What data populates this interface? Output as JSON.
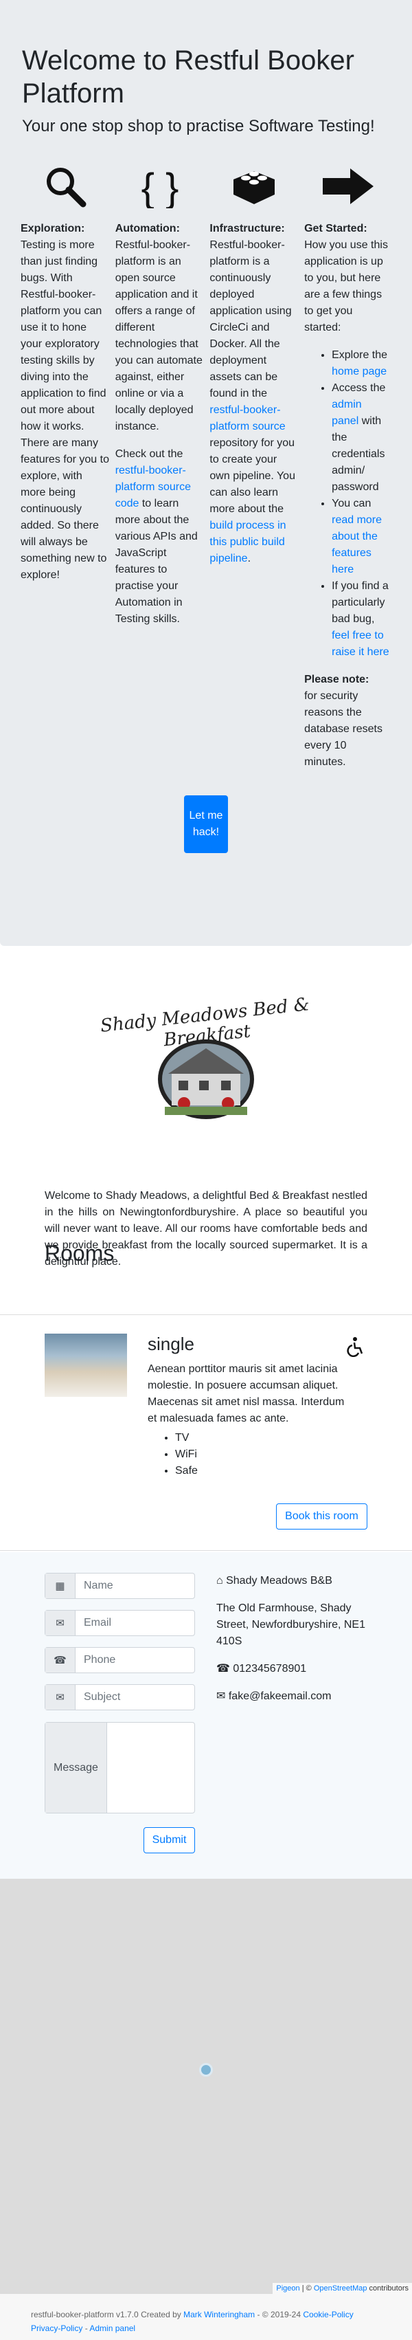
{
  "hero": {
    "title": "Welcome to Restful Booker Platform",
    "lead": "Your one stop shop to practise Software Testing!",
    "exploration": {
      "heading": "Exploration:",
      "text": "Testing is more than just finding bugs. With Restful-booker-platform you can use it to hone your exploratory testing skills by diving into the application to find out more about how it works. There are many features for you to explore, with more being continuously added. So there will always be something new to explore!"
    },
    "automation": {
      "heading": "Automation:",
      "text": "Restful-booker-platform is an open source application and it offers a range of different technologies that you can automate against, either online or via a locally deployed instance.",
      "text2_pre": "Check out the ",
      "link": "restful-booker-platform source code",
      "text2_post": " to learn more about the various APIs and JavaScript features to practise your Automation in Testing skills."
    },
    "infrastructure": {
      "heading": "Infrastructure:",
      "text_pre": "Restful-booker-platform is a continuously deployed application using CircleCi and Docker. All the deployment assets can be found in the ",
      "link1": "restful-booker-platform source",
      "text_mid": " repository for you to create your own pipeline. You can also learn more about the ",
      "link2": "build process in this public build pipeline",
      "text_post": "."
    },
    "started": {
      "heading": "Get Started:",
      "text": "How you use this application is up to you, but here are a few things to get you started:",
      "li1_pre": "Explore the ",
      "li1_link": "home page",
      "li2_pre": "Access the ",
      "li2_link": "admin panel",
      "li2_post": " with the credentials admin/ password",
      "li3_pre": "You can ",
      "li3_link": "read more about the features here",
      "li4_pre": "If you find a particularly bad bug, ",
      "li4_link": "feel free to raise it here",
      "note_heading": "Please note:",
      "note_text": "for security reasons the database resets every 10 minutes."
    },
    "button": "Let me hack!",
    "icons": [
      "search-icon",
      "braces-icon",
      "lego-brick-icon",
      "arrow-right-icon"
    ]
  },
  "hotel": {
    "logo_text": "Shady Meadows Bed & Breakfast",
    "description": "Welcome to Shady Meadows, a delightful Bed & Breakfast nestled in the hills on Newingtonfordburyshire. A place so beautiful you will never want to leave. All our rooms have comfortable beds and we provide breakfast from the locally sourced supermarket. It is a delightful place."
  },
  "rooms": {
    "heading": "Rooms",
    "items": [
      {
        "type": "single",
        "description": "Aenean porttitor mauris sit amet lacinia molestie. In posuere accumsan aliquet. Maecenas sit amet nisl massa. Interdum et malesuada fames ac ante.",
        "features": [
          "TV",
          "WiFi",
          "Safe"
        ],
        "button": "Book this room",
        "accessible_icon": "wheelchair-icon"
      }
    ]
  },
  "contact": {
    "name_placeholder": "Name",
    "email_placeholder": "Email",
    "phone_placeholder": "Phone",
    "subject_placeholder": "Subject",
    "message_label": "Message",
    "submit": "Submit",
    "business_name": "Shady Meadows B&B",
    "address": "The Old Farmhouse, Shady Street, Newfordburyshire, NE1 410S",
    "phone": "012345678901",
    "email": "fake@fakeemail.com"
  },
  "map": {
    "attr_pigeon": "Pigeon",
    "attr_sep": " | © ",
    "attr_osm": "OpenStreetMap",
    "attr_post": " contributors"
  },
  "footer": {
    "text_pre": "restful-booker-platform v1.7.0 Created by ",
    "author": "Mark Winteringham",
    "text_mid": " - © 2019-24 ",
    "cookie": "Cookie-Policy",
    "sep": " - ",
    "privacy": "Privacy-Policy",
    "admin": "Admin panel"
  }
}
